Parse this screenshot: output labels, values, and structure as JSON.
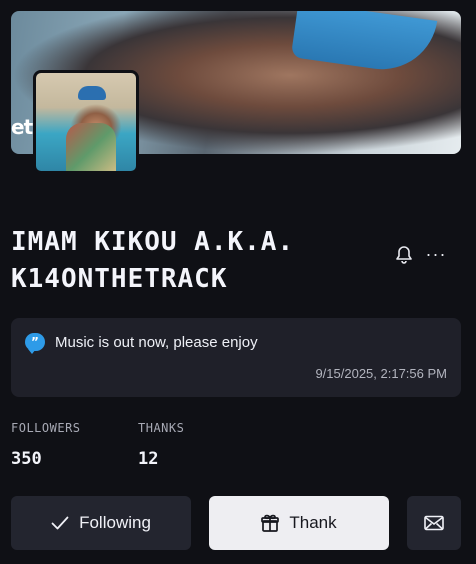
{
  "profile": {
    "name": "IMAM KIKOU A.K.A. K14ONTHETRACK",
    "banner_text": "etr"
  },
  "header_actions": {
    "more_label": "···"
  },
  "status": {
    "icon_glyph": "”",
    "message": "Music is out now, please enjoy",
    "timestamp": "9/15/2025, 2:17:56 PM"
  },
  "stats": {
    "followers_label": "FOLLOWERS",
    "followers_value": "350",
    "thanks_label": "THANKS",
    "thanks_value": "12"
  },
  "actions": {
    "following_label": "Following",
    "thank_label": "Thank"
  },
  "colors": {
    "background": "#0f1015",
    "card": "#1f2029",
    "accent_blue": "#2e9be8",
    "thank_button": "#eeeef2"
  }
}
